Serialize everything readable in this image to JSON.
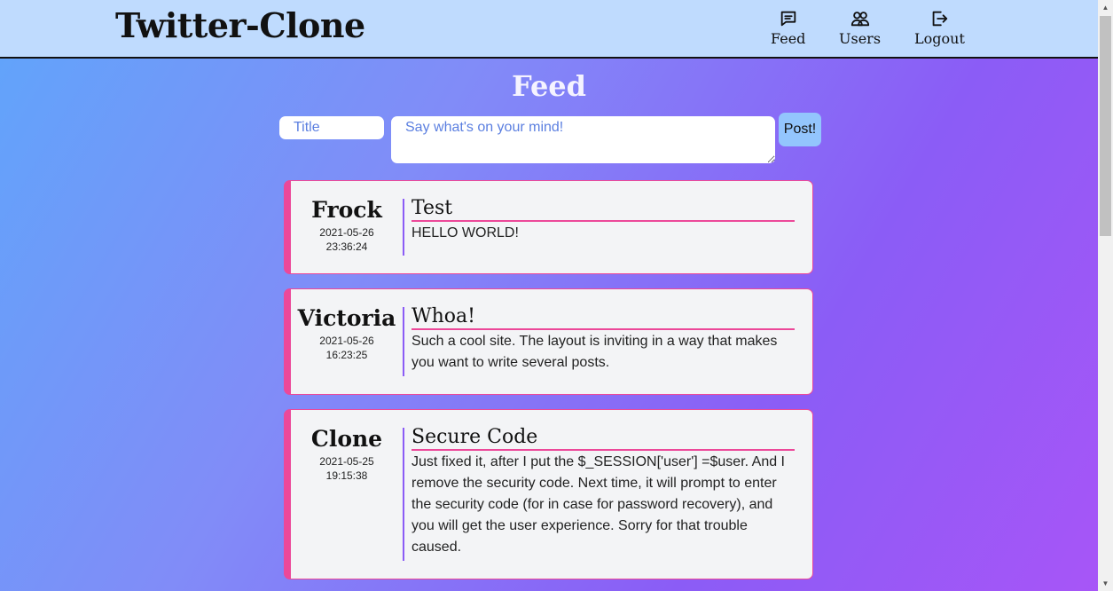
{
  "navbar": {
    "brand": "Twitter-Clone",
    "items": [
      {
        "label": "Feed",
        "icon": "chat-icon"
      },
      {
        "label": "Users",
        "icon": "users-icon"
      },
      {
        "label": "Logout",
        "icon": "logout-icon"
      }
    ]
  },
  "page": {
    "title": "Feed"
  },
  "composer": {
    "title_placeholder": "Title",
    "body_placeholder": "Say what's on your mind!",
    "post_label": "Post!"
  },
  "posts": [
    {
      "author": "Frock",
      "date": "2021-05-26",
      "time": "23:36:24",
      "title": "Test",
      "body": "HELLO WORLD!"
    },
    {
      "author": "Victoria",
      "date": "2021-05-26",
      "time": "16:23:25",
      "title": "Whoa!",
      "body": "Such a cool site. The layout is inviting in a way that makes you want to write several posts."
    },
    {
      "author": "Clone",
      "date": "2021-05-25",
      "time": "19:15:38",
      "title": "Secure Code",
      "body": "Just fixed it, after I put the $_SESSION['user'] =$user. And I remove the security code. Next time, it will prompt to enter the security code (for in case for password recovery), and you will get the user experience. Sorry for that trouble caused."
    }
  ],
  "colors": {
    "navbar": "#bfdbfe",
    "accent_pink": "#ec4899",
    "accent_purple": "#8b5cf6",
    "post_button": "#93c5fd"
  }
}
